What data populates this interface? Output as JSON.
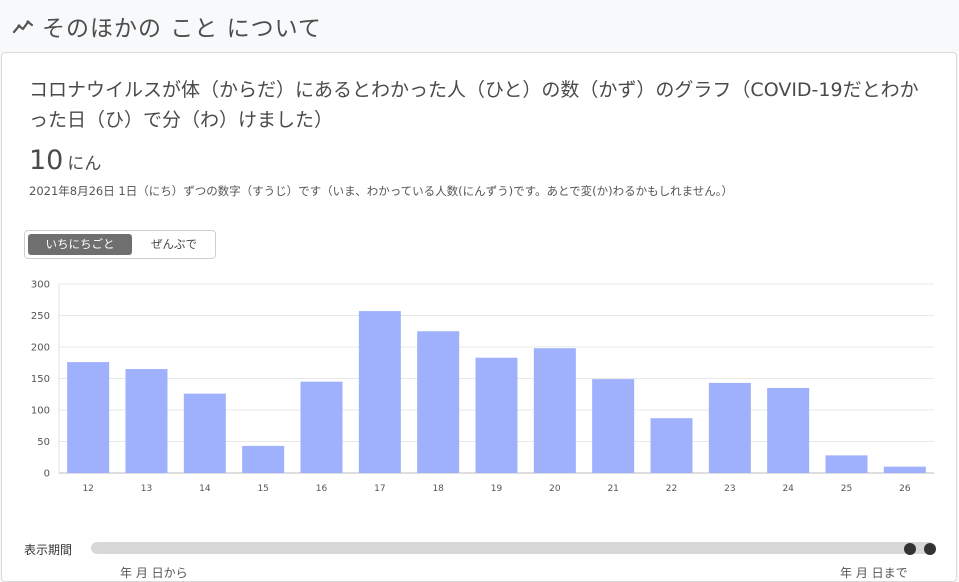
{
  "section": {
    "title": "そのほかの こと について",
    "icon": "line-chart-icon"
  },
  "card": {
    "title": "コロナウイルスが体（からだ）にあるとわかった人（ひと）の数（かず）のグラフ（COVID-19だとわかった日（ひ）で分（わ）けました）",
    "value": "10",
    "unit": "にん",
    "note": "2021年8月26日 1日（にち）ずつの数字（すうじ）です（いま、わかっている人数(にんずう)です。あとで変(か)わるかもしれません。）"
  },
  "toggle": {
    "daily_label": "いちにちごと",
    "total_label": "ぜんぶで",
    "active": "daily"
  },
  "chart_data": {
    "type": "bar",
    "categories": [
      "12",
      "13",
      "14",
      "15",
      "16",
      "17",
      "18",
      "19",
      "20",
      "21",
      "22",
      "23",
      "24",
      "25",
      "26"
    ],
    "values": [
      176,
      165,
      126,
      43,
      145,
      257,
      225,
      183,
      198,
      149,
      87,
      143,
      135,
      28,
      10
    ],
    "ylim": [
      0,
      300
    ],
    "yticks": [
      0,
      50,
      100,
      150,
      200,
      250,
      300
    ],
    "grid": true,
    "bar_color": "#9fb0fc"
  },
  "slider": {
    "label": "表示期間",
    "range_start": "年 月 日から",
    "range_end": "年 月 日まで"
  }
}
